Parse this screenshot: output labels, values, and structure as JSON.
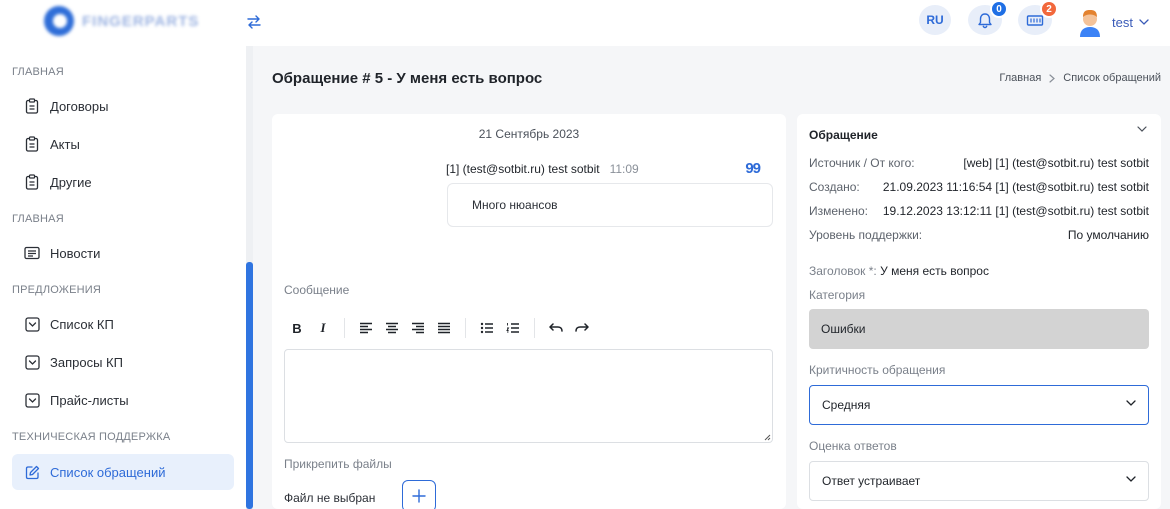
{
  "header": {
    "logo_text": "FINGERPARTS",
    "lang": "RU",
    "notifications_count": "0",
    "basket_count": "2",
    "user_name": "test"
  },
  "sidebar": {
    "sections": [
      {
        "title": "ГЛАВНАЯ"
      },
      {
        "title": "ГЛАВНАЯ"
      },
      {
        "title": "ПРЕДЛОЖЕНИЯ"
      },
      {
        "title": "ТЕХНИЧЕСКАЯ ПОДДЕРЖКА"
      }
    ],
    "items": [
      {
        "label": "Договоры",
        "icon": "clipboard-icon"
      },
      {
        "label": "Акты",
        "icon": "clipboard-icon"
      },
      {
        "label": "Другие",
        "icon": "clipboard-icon"
      },
      {
        "label": "Новости",
        "icon": "newspaper-icon"
      },
      {
        "label": "Список КП",
        "icon": "inbox-icon"
      },
      {
        "label": "Запросы КП",
        "icon": "inbox-icon"
      },
      {
        "label": "Прайс-листы",
        "icon": "inbox-icon"
      },
      {
        "label": "Список обращений",
        "icon": "edit-icon",
        "active": true
      }
    ]
  },
  "page": {
    "title": "Обращение # 5 - У меня есть вопрос",
    "breadcrumb": [
      "Главная",
      "Список обращений"
    ]
  },
  "chat": {
    "date": "21 Сентябрь 2023",
    "message": {
      "author": "[1] (test@sotbit.ru) test sotbit",
      "time": "11:09",
      "text": "Много нюансов"
    }
  },
  "form": {
    "message_label": "Сообщение",
    "attach_label": "Прикрепить файлы",
    "file_status": "Файл не выбран",
    "toolbar": [
      "bold",
      "italic",
      "align-left",
      "align-center",
      "align-right",
      "align-justify",
      "bullet-list",
      "numbered-list",
      "undo",
      "redo"
    ]
  },
  "ticket": {
    "title": "Обращение",
    "rows": [
      {
        "label": "Источник / От кого:",
        "value": "[web] [1] (test@sotbit.ru) test sotbit"
      },
      {
        "label": "Создано:",
        "value": "21.09.2023 11:16:54 [1] (test@sotbit.ru) test sotbit"
      },
      {
        "label": "Изменено:",
        "value": "19.12.2023 13:12:11 [1] (test@sotbit.ru) test sotbit"
      },
      {
        "label": "Уровень поддержки:",
        "value": "По умолчанию"
      }
    ],
    "subject_label": "Заголовок *:",
    "subject_value": "У меня есть вопрос",
    "category_label": "Категория",
    "category_value": "Ошибки",
    "criticality_label": "Критичность обращения",
    "criticality_value": "Средняя",
    "rating_label": "Оценка ответов",
    "rating_value": "Ответ устраивает"
  },
  "colors": {
    "accent": "#2e6bd8",
    "badge_blue": "#1f6fe5",
    "badge_orange": "#f2683c",
    "disabled_select": "#d3d3d3"
  }
}
